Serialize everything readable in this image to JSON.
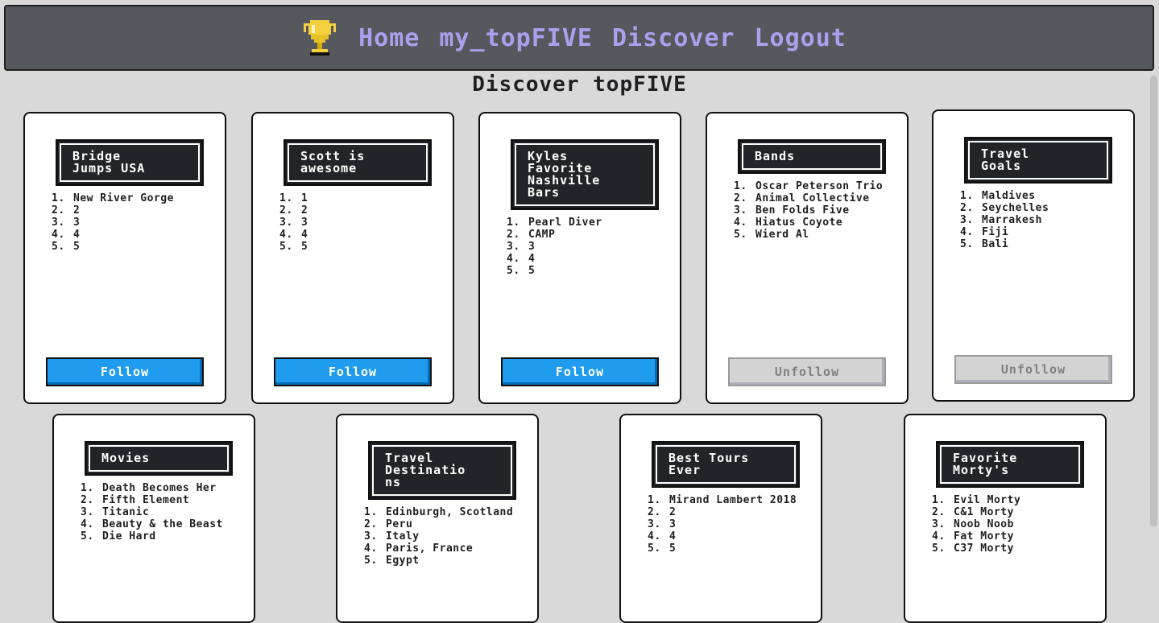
{
  "nav": {
    "trophy_icon": "trophy-icon",
    "links": [
      "Home",
      "my_topFIVE",
      "Discover",
      "Logout"
    ]
  },
  "page": {
    "title": "Discover topFIVE"
  },
  "colors": {
    "follow": "#209cee",
    "nav_link": "#a9a1ee",
    "nav_bg": "#55585c"
  },
  "cards": [
    {
      "title_lines": [
        "Bridge",
        "Jumps USA"
      ],
      "items": [
        "New River Gorge",
        "2",
        "3",
        "4",
        "5"
      ],
      "button": "Follow"
    },
    {
      "title_lines": [
        "Scott is",
        "awesome"
      ],
      "items": [
        "1",
        "2",
        "3",
        "4",
        "5"
      ],
      "button": "Follow"
    },
    {
      "title_lines": [
        "Kyles",
        "Favorite",
        "Nashville",
        "Bars"
      ],
      "items": [
        "Pearl Diver",
        "CAMP",
        "3",
        "4",
        "5"
      ],
      "button": "Follow"
    },
    {
      "title_lines": [
        "Bands"
      ],
      "items": [
        "Oscar Peterson Trio",
        "Animal Collective",
        "Ben Folds Five",
        "Hiatus Coyote",
        "Wierd Al"
      ],
      "button": "Unfollow"
    },
    {
      "title_lines": [
        "Travel",
        "Goals"
      ],
      "items": [
        "Maldives",
        "Seychelles",
        "Marrakesh",
        "Fiji",
        "Bali"
      ],
      "button": "Unfollow"
    },
    {
      "title_lines": [
        "Movies"
      ],
      "items": [
        "Death Becomes Her",
        "Fifth Element",
        "Titanic",
        "Beauty & the Beast",
        "Die Hard"
      ],
      "button": ""
    },
    {
      "title_lines": [
        "Travel",
        "Destinatio",
        "ns"
      ],
      "items": [
        "Edinburgh, Scotland",
        "Peru",
        "Italy",
        "Paris, France",
        "Egypt"
      ],
      "button": ""
    },
    {
      "title_lines": [
        "Best Tours",
        "Ever"
      ],
      "items": [
        "Mirand Lambert 2018",
        "2",
        "3",
        "4",
        "5"
      ],
      "button": ""
    },
    {
      "title_lines": [
        "Favorite",
        "Morty's"
      ],
      "items": [
        "Evil Morty",
        "C&1 Morty",
        "Noob Noob",
        "Fat Morty",
        "C37 Morty"
      ],
      "button": ""
    }
  ]
}
